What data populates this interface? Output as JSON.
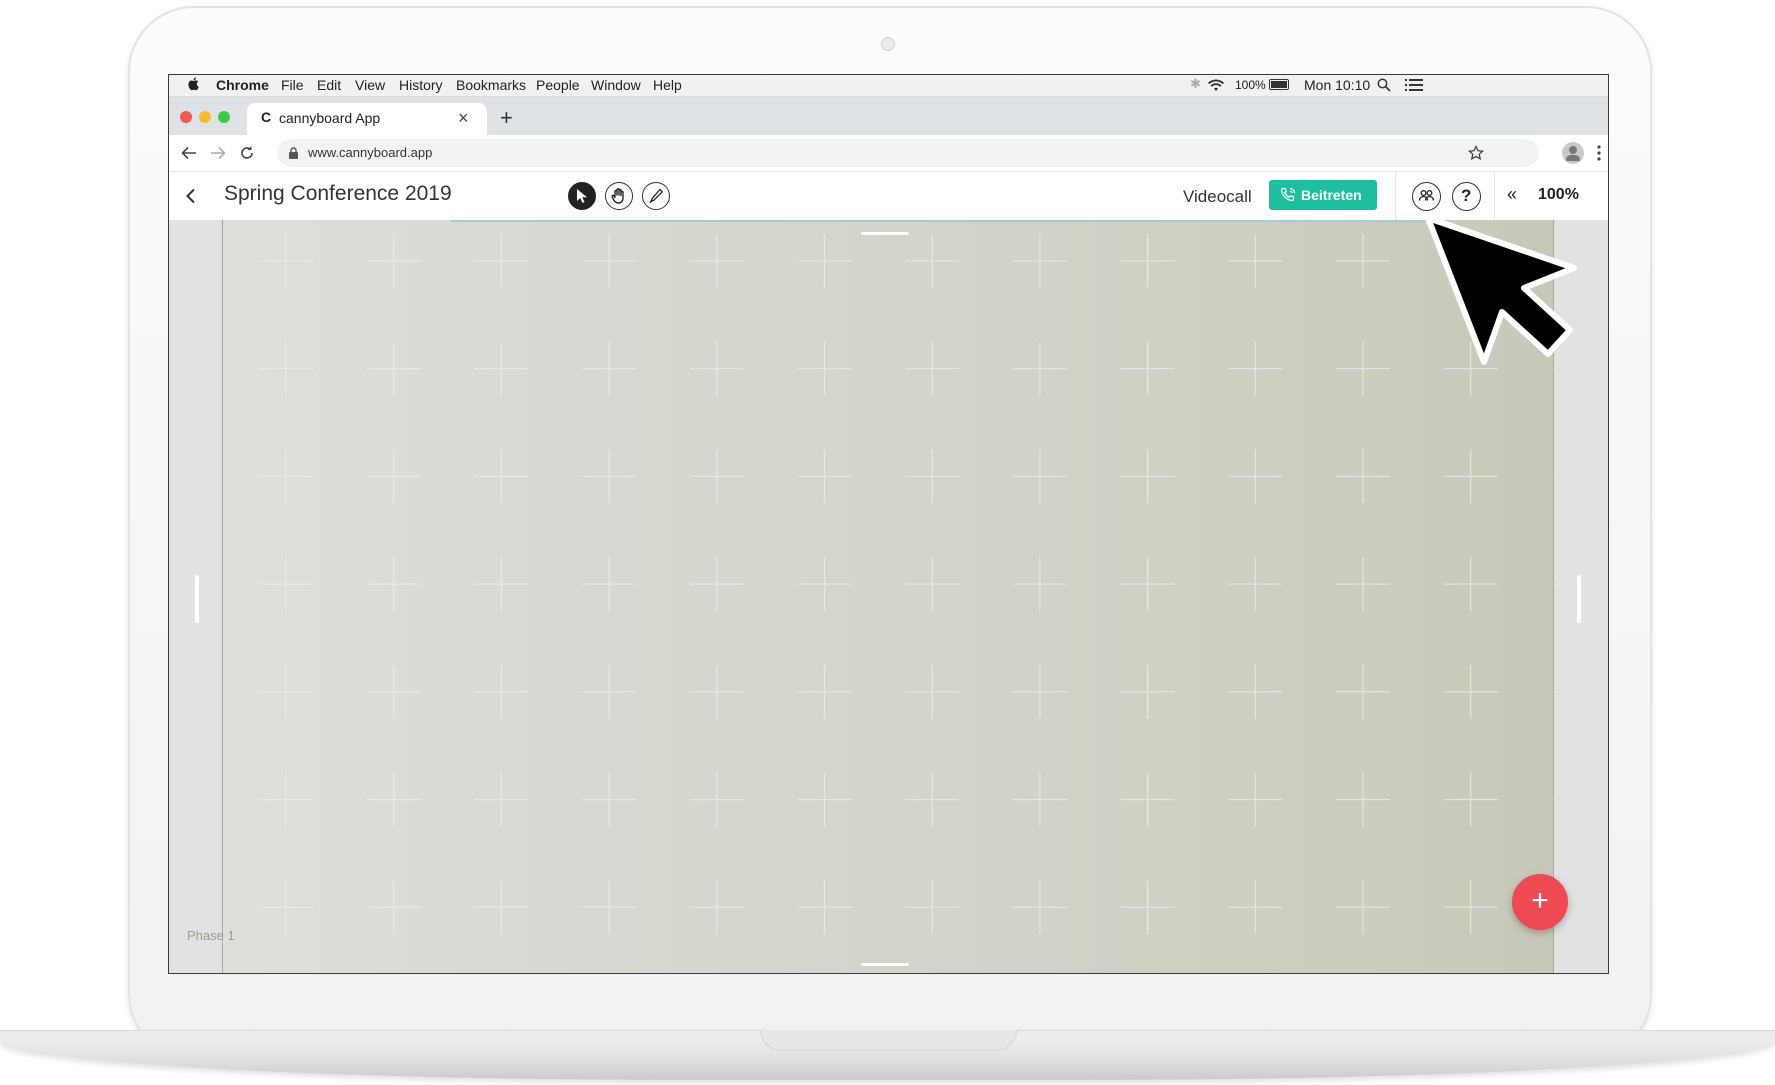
{
  "menubar": {
    "app": "Chrome",
    "items": [
      "File",
      "Edit",
      "View",
      "History",
      "Bookmarks",
      "People",
      "Window",
      "Help"
    ],
    "battery": "100%",
    "clock": "Mon 10:10"
  },
  "browser": {
    "tab_title": "cannyboard App",
    "tab_logo": "C",
    "url": "www.cannyboard.app",
    "new_tab": "+",
    "close": "×"
  },
  "app": {
    "board_title": "Spring Conference 2019",
    "videocall_label": "Videocall",
    "join_label": "Beitreten",
    "zoom_label": "100%",
    "zoom_prefix": "«",
    "tools": [
      "pointer-tool",
      "hand-tool",
      "pen-tool"
    ],
    "accent_color": "#1ebfa0",
    "fab_color": "#ee4a55"
  },
  "board": {
    "phase_label": "Phase 1",
    "fab_label": "+"
  }
}
